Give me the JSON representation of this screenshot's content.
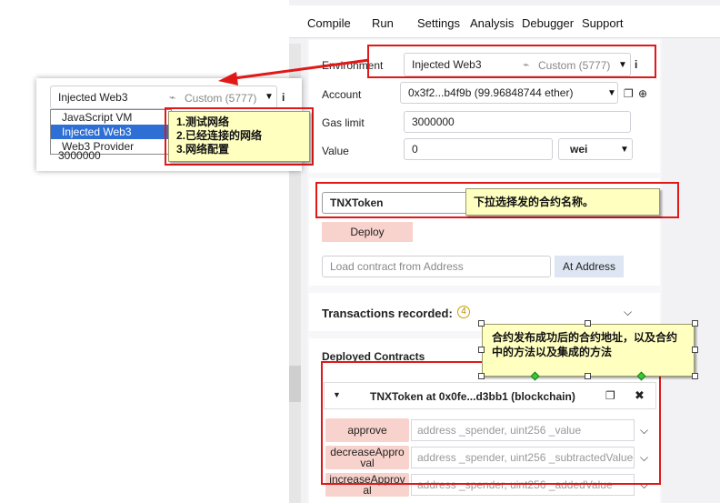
{
  "tabs": [
    "Compile",
    "Run",
    "Settings",
    "Analysis",
    "Debugger",
    "Support"
  ],
  "run": {
    "environment_label": "Environment",
    "environment_value": "Injected Web3",
    "environment_network": "Custom (5777)",
    "account_label": "Account",
    "account_value": "0x3f2...b4f9b (99.96848744 ether)",
    "gas_limit_label": "Gas limit",
    "gas_limit_value": "3000000",
    "value_label": "Value",
    "value_amount": "0",
    "value_unit": "wei",
    "contract_select": "TNXToken",
    "deploy_label": "Deploy",
    "load_placeholder": "Load contract from Address",
    "at_address_label": "At Address",
    "transactions_label": "Transactions recorded:",
    "transactions_count": "4",
    "deployed_label": "Deployed Contracts",
    "instance_title": "TNXToken at 0x0fe...d3bb1 (blockchain)",
    "functions": [
      {
        "name": "approve",
        "params": "address _spender, uint256 _value"
      },
      {
        "name": "decreaseApproval",
        "params": "address _spender, uint256 _subtractedValue"
      },
      {
        "name": "increaseApproval",
        "params": "address _spender, uint256 _addedValue"
      }
    ]
  },
  "inset": {
    "env_value": "Injected Web3",
    "env_network": "Custom (5777)",
    "options": [
      "JavaScript VM",
      "Injected Web3",
      "Web3 Provider"
    ],
    "selected_option": "Injected Web3",
    "partial_value": "3000000"
  },
  "notes": {
    "network_note": [
      "1.测试网络",
      "2.已经连接的网络",
      "3.网络配置"
    ],
    "contract_note": "下拉选择发的合约名称。",
    "deployed_note": "合约发布成功后的合约地址，以及合约中的方法以及集成的方法"
  },
  "colors": {
    "annotation_red": "#e01818",
    "note_bg": "#ffffc0",
    "deploy_btn": "#f8d2cc",
    "at_address_btn": "#dde6f2"
  },
  "icons": [
    "plug-icon",
    "info-icon",
    "copy-icon",
    "plus-circle-icon",
    "close-icon",
    "chevron-down-icon",
    "caret-down-icon"
  ]
}
